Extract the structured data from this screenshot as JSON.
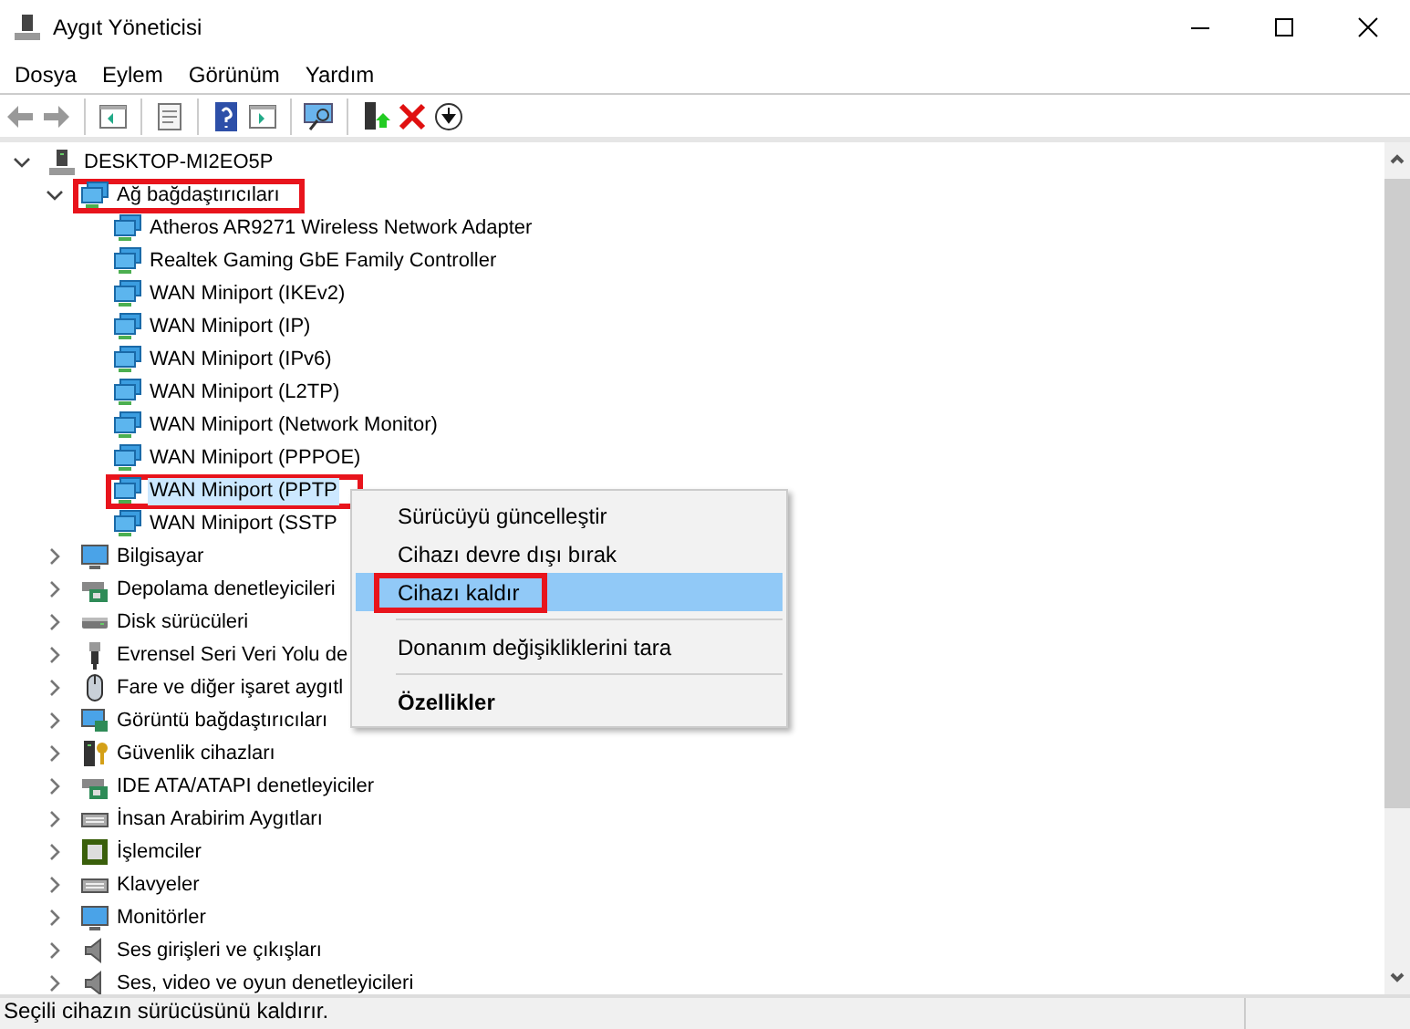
{
  "window": {
    "title": "Aygıt Yöneticisi"
  },
  "menu": [
    "Dosya",
    "Eylem",
    "Görünüm",
    "Yardım"
  ],
  "tree": [
    {
      "label": "DESKTOP-MI2EO5P",
      "kind": "computer-root",
      "expanded": true,
      "selected": false,
      "highlighted": false,
      "children": [
        {
          "label": "Ağ bağdaştırıcıları",
          "kind": "network",
          "expanded": true,
          "selected": false,
          "highlighted": true,
          "children": [
            {
              "label": "Atheros AR9271 Wireless Network Adapter",
              "kind": "network",
              "selected": false,
              "highlighted": false
            },
            {
              "label": "Realtek Gaming GbE Family Controller",
              "kind": "network",
              "selected": false,
              "highlighted": false
            },
            {
              "label": "WAN Miniport (IKEv2)",
              "kind": "network",
              "selected": false,
              "highlighted": false
            },
            {
              "label": "WAN Miniport (IP)",
              "kind": "network",
              "selected": false,
              "highlighted": false
            },
            {
              "label": "WAN Miniport (IPv6)",
              "kind": "network",
              "selected": false,
              "highlighted": false
            },
            {
              "label": "WAN Miniport (L2TP)",
              "kind": "network",
              "selected": false,
              "highlighted": false
            },
            {
              "label": "WAN Miniport (Network Monitor)",
              "kind": "network",
              "selected": false,
              "highlighted": false
            },
            {
              "label": "WAN Miniport (PPPOE)",
              "kind": "network",
              "selected": false,
              "highlighted": false
            },
            {
              "label": "WAN Miniport (PPTP",
              "kind": "network",
              "selected": true,
              "highlighted": true
            },
            {
              "label": "WAN Miniport (SSTP",
              "kind": "network",
              "selected": false,
              "highlighted": false
            }
          ]
        },
        {
          "label": "Bilgisayar",
          "kind": "monitor",
          "expanded": false,
          "selected": false,
          "highlighted": false
        },
        {
          "label": "Depolama denetleyicileri",
          "kind": "storage",
          "expanded": false,
          "selected": false,
          "highlighted": false
        },
        {
          "label": "Disk sürücüleri",
          "kind": "disk",
          "expanded": false,
          "selected": false,
          "highlighted": false
        },
        {
          "label": "Evrensel Seri Veri Yolu de",
          "kind": "usb",
          "expanded": false,
          "selected": false,
          "highlighted": false
        },
        {
          "label": "Fare ve diğer işaret aygıtl",
          "kind": "mouse",
          "expanded": false,
          "selected": false,
          "highlighted": false
        },
        {
          "label": "Görüntü bağdaştırıcıları",
          "kind": "display",
          "expanded": false,
          "selected": false,
          "highlighted": false
        },
        {
          "label": "Güvenlik cihazları",
          "kind": "security",
          "expanded": false,
          "selected": false,
          "highlighted": false
        },
        {
          "label": "IDE ATA/ATAPI denetleyiciler",
          "kind": "storage",
          "expanded": false,
          "selected": false,
          "highlighted": false
        },
        {
          "label": "İnsan Arabirim Aygıtları",
          "kind": "keyboard",
          "expanded": false,
          "selected": false,
          "highlighted": false
        },
        {
          "label": "İşlemciler",
          "kind": "cpu",
          "expanded": false,
          "selected": false,
          "highlighted": false
        },
        {
          "label": "Klavyeler",
          "kind": "keyboard",
          "expanded": false,
          "selected": false,
          "highlighted": false
        },
        {
          "label": "Monitörler",
          "kind": "monitor",
          "expanded": false,
          "selected": false,
          "highlighted": false
        },
        {
          "label": "Ses girişleri ve çıkışları",
          "kind": "audio",
          "expanded": false,
          "selected": false,
          "highlighted": false
        },
        {
          "label": "Ses, video ve oyun denetleyicileri",
          "kind": "audio",
          "expanded": false,
          "selected": false,
          "highlighted": false
        }
      ]
    }
  ],
  "context_menu": [
    {
      "kind": "item",
      "label": "Sürücüyü güncelleştir",
      "selected": false,
      "highlighted": false,
      "bold": false
    },
    {
      "kind": "item",
      "label": "Cihazı devre dışı bırak",
      "selected": false,
      "highlighted": false,
      "bold": false
    },
    {
      "kind": "item",
      "label": "Cihazı kaldır",
      "selected": true,
      "highlighted": true,
      "bold": false
    },
    {
      "kind": "separator"
    },
    {
      "kind": "item",
      "label": "Donanım değişikliklerini tara",
      "selected": false,
      "highlighted": false,
      "bold": false
    },
    {
      "kind": "separator"
    },
    {
      "kind": "item",
      "label": "Özellikler",
      "selected": false,
      "highlighted": false,
      "bold": true
    }
  ],
  "status_bar": {
    "text": "Seçili cihazın sürücüsünü kaldırır."
  }
}
